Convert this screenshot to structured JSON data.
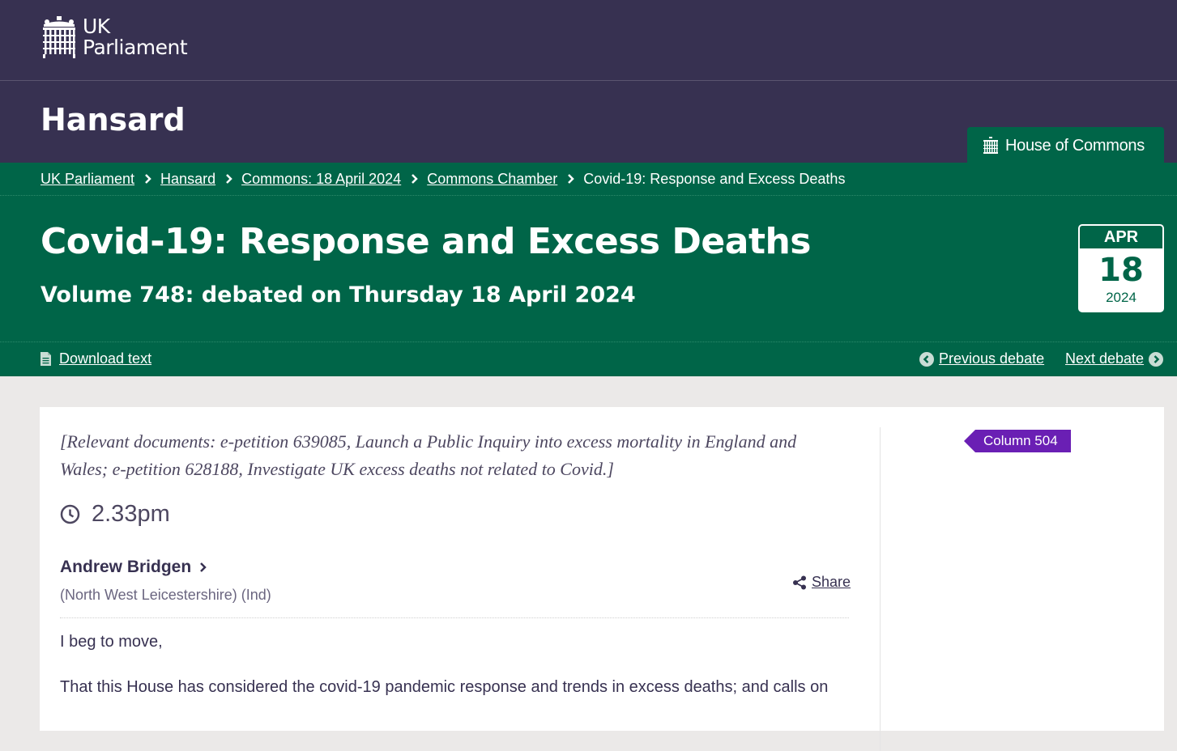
{
  "header": {
    "logo_line1": "UK",
    "logo_line2": "Parliament",
    "section_title": "Hansard",
    "house_label": "House of Commons"
  },
  "breadcrumb": {
    "items": [
      "UK Parliament",
      "Hansard",
      "Commons: 18 April 2024",
      "Commons Chamber"
    ],
    "current": "Covid-19: Response and Excess Deaths"
  },
  "debate": {
    "title": "Covid-19: Response and Excess Deaths",
    "subtitle": "Volume 748: debated on Thursday 18 April 2024",
    "date": {
      "month": "APR",
      "day": "18",
      "year": "2024"
    }
  },
  "actions": {
    "download": "Download text",
    "previous": "Previous debate",
    "next": "Next debate"
  },
  "content": {
    "relevant_documents": "[Relevant documents: e-petition 639085, Launch a Public Inquiry into excess mortality in England and Wales; e-petition 628188, Investigate UK excess deaths not related to Covid.]",
    "time": "2.33pm",
    "speaker_name": "Andrew Bridgen",
    "speaker_constituency": "(North West Leicestershire) (Ind)",
    "share_label": "Share",
    "paragraph1": "I beg to move,",
    "paragraph2": "That this House has considered the covid-19 pandemic response and trends in excess deaths; and calls on",
    "column_label": "Column 504"
  },
  "colors": {
    "purple": "#373151",
    "green": "#006548",
    "column_purple": "#6a1fb4"
  }
}
